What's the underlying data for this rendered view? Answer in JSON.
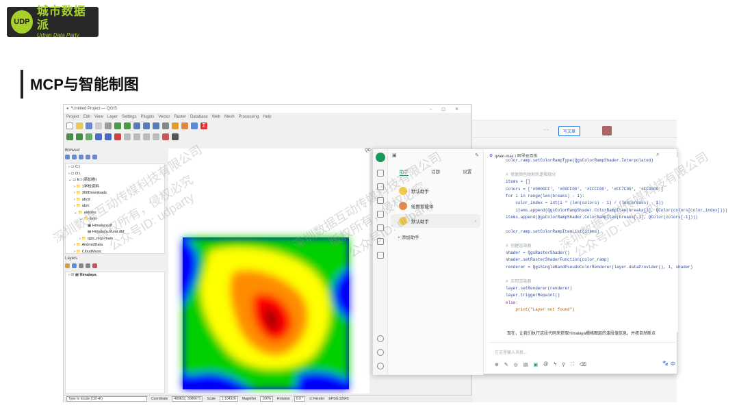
{
  "logo": {
    "cn": "城市数据派",
    "en": "Urban Data Party",
    "badge": "UDP"
  },
  "slide_title": "MCP与智能制图",
  "watermarks": [
    "深圳数据互动传媒科技有限公司",
    "版权所有，侵权必究",
    "公众号ID: udparty"
  ],
  "qgis": {
    "window_title": "*Untitled Project — QGIS",
    "menu": [
      "Project",
      "Edit",
      "View",
      "Layer",
      "Settings",
      "Plugins",
      "Vector",
      "Raster",
      "Database",
      "Web",
      "Mesh",
      "Processing",
      "Help"
    ],
    "browser_title": "Browser",
    "browser_items": [
      "C:\\",
      "D:\\",
      "E:\\ (新加卷)",
      "1学校资料",
      "360Downloads",
      "abcd",
      "abm",
      "aldemo",
      "dem",
      "Himalaya.tif",
      "Himalaya.tif.vat.dbf",
      "qgis_mcp-main",
      "AndroidData",
      "CloudMusic"
    ],
    "layers_title": "Layers",
    "layer_name": "Himalaya",
    "locate_placeholder": "Type to locate (Ctrl+K)",
    "status": {
      "coord_label": "Coordinate",
      "coord": "489832, 3086671",
      "scale_label": "Scale",
      "scale": "1:104326",
      "mag_label": "Magnifier",
      "mag": "100%",
      "rot_label": "Rotation",
      "rot": "0.0 °",
      "render": "Render",
      "crs": "EPSG:32645"
    },
    "qc": "QC"
  },
  "browser": {
    "write_button": "写文章"
  },
  "chat": {
    "title": "qwen-max | 阿里云百炼",
    "tabs": [
      "助手",
      "话题",
      "设置"
    ],
    "assistants": [
      "默认助手",
      "绘图智能体",
      "默认助手"
    ],
    "add_assistant": "+ 添加助手",
    "code_lines": [
      "color_ramp.setColorRampType(QgsColorRampShader.Interpolated)",
      "",
      "# 修复颜色映射的逻辑部分",
      "items = []",
      "colors = ['#0000FF', '#00FF00', '#FFFF00', '#FF7F00', '#FF0000']",
      "for i in range(len(breaks) - 1):",
      "    color_index = int(i * (len(colors) - 1) / (len(breaks) - 1))",
      "    items.append(QgsColorRampShader.ColorRampItem(breaks[i], QColor(colors[color_index])))",
      "items.append(QgsColorRampShader.ColorRampItem(breaks[-1], QColor(colors[-1])))",
      "",
      "color_ramp.setColorRampItemList(items)",
      "",
      "# 创建渲染器",
      "shader = QgsRasterShader()",
      "shader.setRasterShaderFunction(color_ramp)",
      "renderer = QgsSingleBandPseudoColorRenderer(layer.dataProvider(), 1, shader)",
      "",
      "# 应用渲染器",
      "layer.setRenderer(renderer)",
      "layer.triggerRepaint()",
      "else:",
      "    print(\"Layer not found\")"
    ],
    "message": "现在，让我们执行这段代码来获取Himalaya栅格图层的波段值信息，并按自然断点",
    "input_placeholder": "在这里输入消息...",
    "ime": "中"
  },
  "colors": {
    "accent": "#1a9a5a",
    "logo_green": "#a7d12a"
  }
}
